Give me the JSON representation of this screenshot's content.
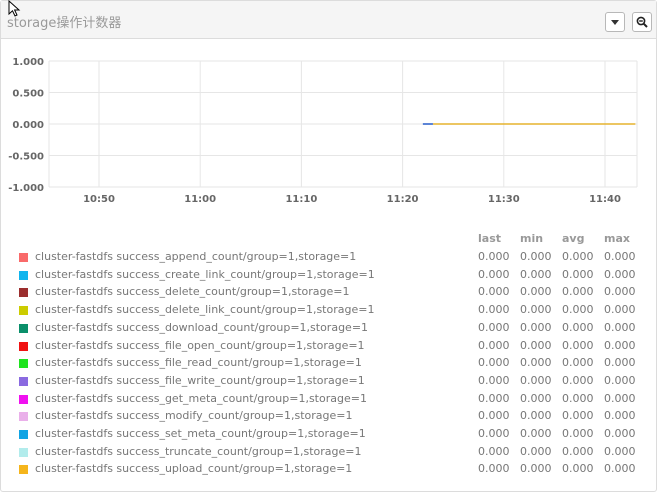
{
  "panel": {
    "title": "storage操作计数器"
  },
  "chart_data": {
    "type": "line",
    "ylim": [
      -1,
      1
    ],
    "yticks": [
      "1.000",
      "0.500",
      "0.000",
      "-0.500",
      "-1.000"
    ],
    "xticks": [
      "10:50",
      "11:00",
      "11:10",
      "11:20",
      "11:30",
      "11:40"
    ],
    "grid": true,
    "series_line": {
      "segments": [
        {
          "color": "#3366cc",
          "from": "11:22",
          "to": "11:23",
          "value": 0.0
        },
        {
          "color": "#e5b32f",
          "from": "11:23",
          "to": "11:43",
          "value": 0.0
        }
      ]
    }
  },
  "legend": {
    "headers": [
      "last",
      "min",
      "avg",
      "max"
    ],
    "rows": [
      {
        "name": "cluster-fastdfs success_append_count/group=1,storage=1",
        "color": "#f96a6a",
        "last": "0.000",
        "min": "0.000",
        "avg": "0.000",
        "max": "0.000"
      },
      {
        "name": "cluster-fastdfs success_create_link_count/group=1,storage=1",
        "color": "#11b5ee",
        "last": "0.000",
        "min": "0.000",
        "avg": "0.000",
        "max": "0.000"
      },
      {
        "name": "cluster-fastdfs success_delete_count/group=1,storage=1",
        "color": "#9b2e2e",
        "last": "0.000",
        "min": "0.000",
        "avg": "0.000",
        "max": "0.000"
      },
      {
        "name": "cluster-fastdfs success_delete_link_count/group=1,storage=1",
        "color": "#cccc00",
        "last": "0.000",
        "min": "0.000",
        "avg": "0.000",
        "max": "0.000"
      },
      {
        "name": "cluster-fastdfs success_download_count/group=1,storage=1",
        "color": "#0a8f6a",
        "last": "0.000",
        "min": "0.000",
        "avg": "0.000",
        "max": "0.000"
      },
      {
        "name": "cluster-fastdfs success_file_open_count/group=1,storage=1",
        "color": "#f01212",
        "last": "0.000",
        "min": "0.000",
        "avg": "0.000",
        "max": "0.000"
      },
      {
        "name": "cluster-fastdfs success_file_read_count/group=1,storage=1",
        "color": "#1ee41e",
        "last": "0.000",
        "min": "0.000",
        "avg": "0.000",
        "max": "0.000"
      },
      {
        "name": "cluster-fastdfs success_file_write_count/group=1,storage=1",
        "color": "#8a6ae0",
        "last": "0.000",
        "min": "0.000",
        "avg": "0.000",
        "max": "0.000"
      },
      {
        "name": "cluster-fastdfs success_get_meta_count/group=1,storage=1",
        "color": "#f011f0",
        "last": "0.000",
        "min": "0.000",
        "avg": "0.000",
        "max": "0.000"
      },
      {
        "name": "cluster-fastdfs success_modify_count/group=1,storage=1",
        "color": "#eab0ea",
        "last": "0.000",
        "min": "0.000",
        "avg": "0.000",
        "max": "0.000"
      },
      {
        "name": "cluster-fastdfs success_set_meta_count/group=1,storage=1",
        "color": "#11a4e4",
        "last": "0.000",
        "min": "0.000",
        "avg": "0.000",
        "max": "0.000"
      },
      {
        "name": "cluster-fastdfs success_truncate_count/group=1,storage=1",
        "color": "#b2ecec",
        "last": "0.000",
        "min": "0.000",
        "avg": "0.000",
        "max": "0.000"
      },
      {
        "name": "cluster-fastdfs success_upload_count/group=1,storage=1",
        "color": "#f5b51c",
        "last": "0.000",
        "min": "0.000",
        "avg": "0.000",
        "max": "0.000"
      }
    ]
  },
  "icons": {
    "dropdown": "caret-down-icon",
    "zoom": "zoom-out-icon",
    "cursor": "mouse-cursor-icon"
  }
}
